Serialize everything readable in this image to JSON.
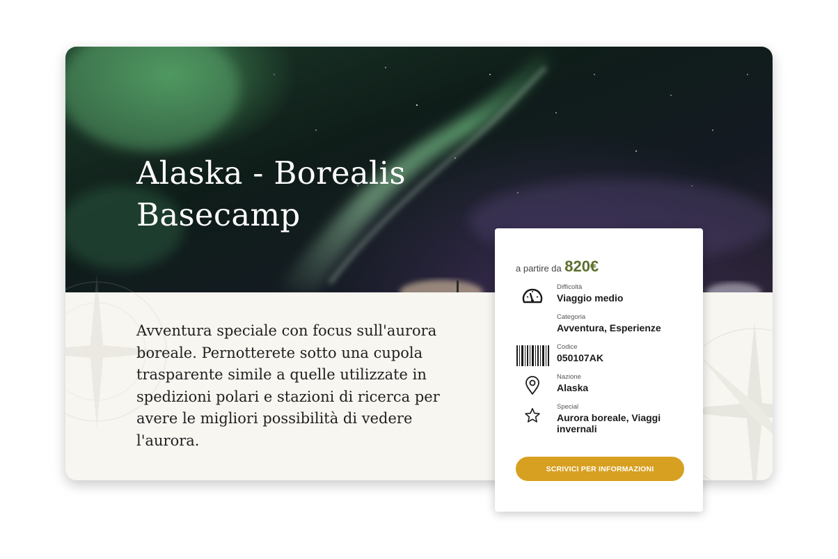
{
  "hero": {
    "title": "Alaska - Borealis Basecamp"
  },
  "description": "Avventura speciale con focus sull'aurora boreale. Pernotterete sotto una cupola trasparente simile a quelle utilizzate in spedizioni polari e stazioni di ricerca per avere le migliori possibilità di vedere l'aurora.",
  "panel": {
    "price_label": "a partire da",
    "price_value": "820€",
    "details": [
      {
        "icon": "speedometer-icon",
        "label": "Difficoltà",
        "value": "Viaggio medio"
      },
      {
        "icon": "",
        "label": "Categoria",
        "value": "Avventura, Esperienze"
      },
      {
        "icon": "barcode-icon",
        "label": "Codice",
        "value": "050107AK"
      },
      {
        "icon": "map-pin-icon",
        "label": "Nazione",
        "value": "Alaska"
      },
      {
        "icon": "star-icon",
        "label": "Special",
        "value": "Aurora boreale, Viaggi invernali"
      }
    ],
    "cta_label": "SCRIVICI PER INFORMAZIONI"
  },
  "colors": {
    "price": "#5b6e2b",
    "cta": "#d7a021",
    "card_background": "#f7f6f1"
  }
}
